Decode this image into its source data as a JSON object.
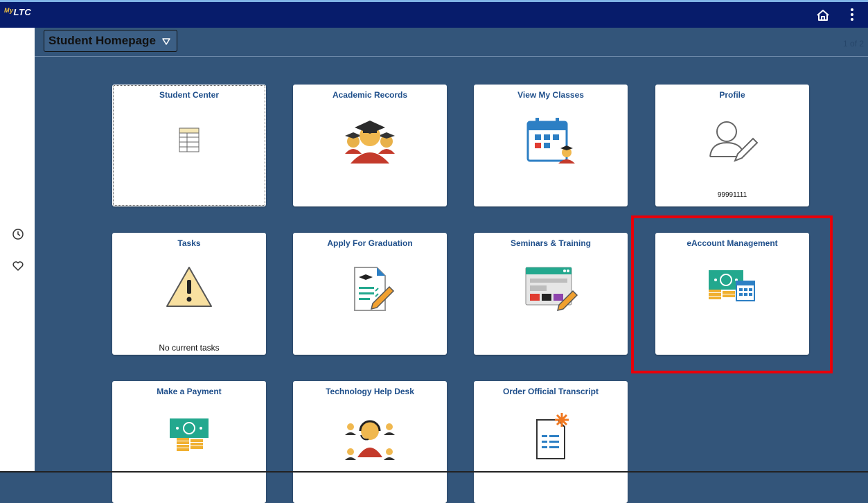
{
  "header": {
    "logo_text": "LTC",
    "logo_prefix": "My"
  },
  "page_selector": {
    "label": "Student Homepage"
  },
  "pager": {
    "text": "1 of 2"
  },
  "tiles": [
    {
      "title": "Student Center",
      "sub": ""
    },
    {
      "title": "Academic Records",
      "sub": ""
    },
    {
      "title": "View My Classes",
      "sub": ""
    },
    {
      "title": "Profile",
      "sub": "99991111"
    },
    {
      "title": "Tasks",
      "sub": "No current tasks"
    },
    {
      "title": "Apply For Graduation",
      "sub": ""
    },
    {
      "title": "Seminars & Training",
      "sub": ""
    },
    {
      "title": "eAccount Management",
      "sub": ""
    },
    {
      "title": "Make a Payment",
      "sub": ""
    },
    {
      "title": "Technology Help Desk",
      "sub": ""
    },
    {
      "title": "Order Official Transcript",
      "sub": ""
    }
  ],
  "colors": {
    "header": "#071c6b",
    "background": "#33557a",
    "tile_title": "#1f4f8b",
    "highlight": "#e8000a"
  },
  "icons": {
    "header": [
      "home-icon",
      "more-options-icon"
    ],
    "leftbar": [
      "clock-icon",
      "heart-icon"
    ],
    "tiles": [
      "student-center-icon",
      "graduation-cap-icon",
      "class-calendar-icon",
      "profile-edit-icon",
      "warning-icon",
      "graduation-document-icon",
      "seminar-window-icon",
      "account-money-icon",
      "money-icon",
      "help-desk-icon",
      "transcript-icon"
    ]
  }
}
